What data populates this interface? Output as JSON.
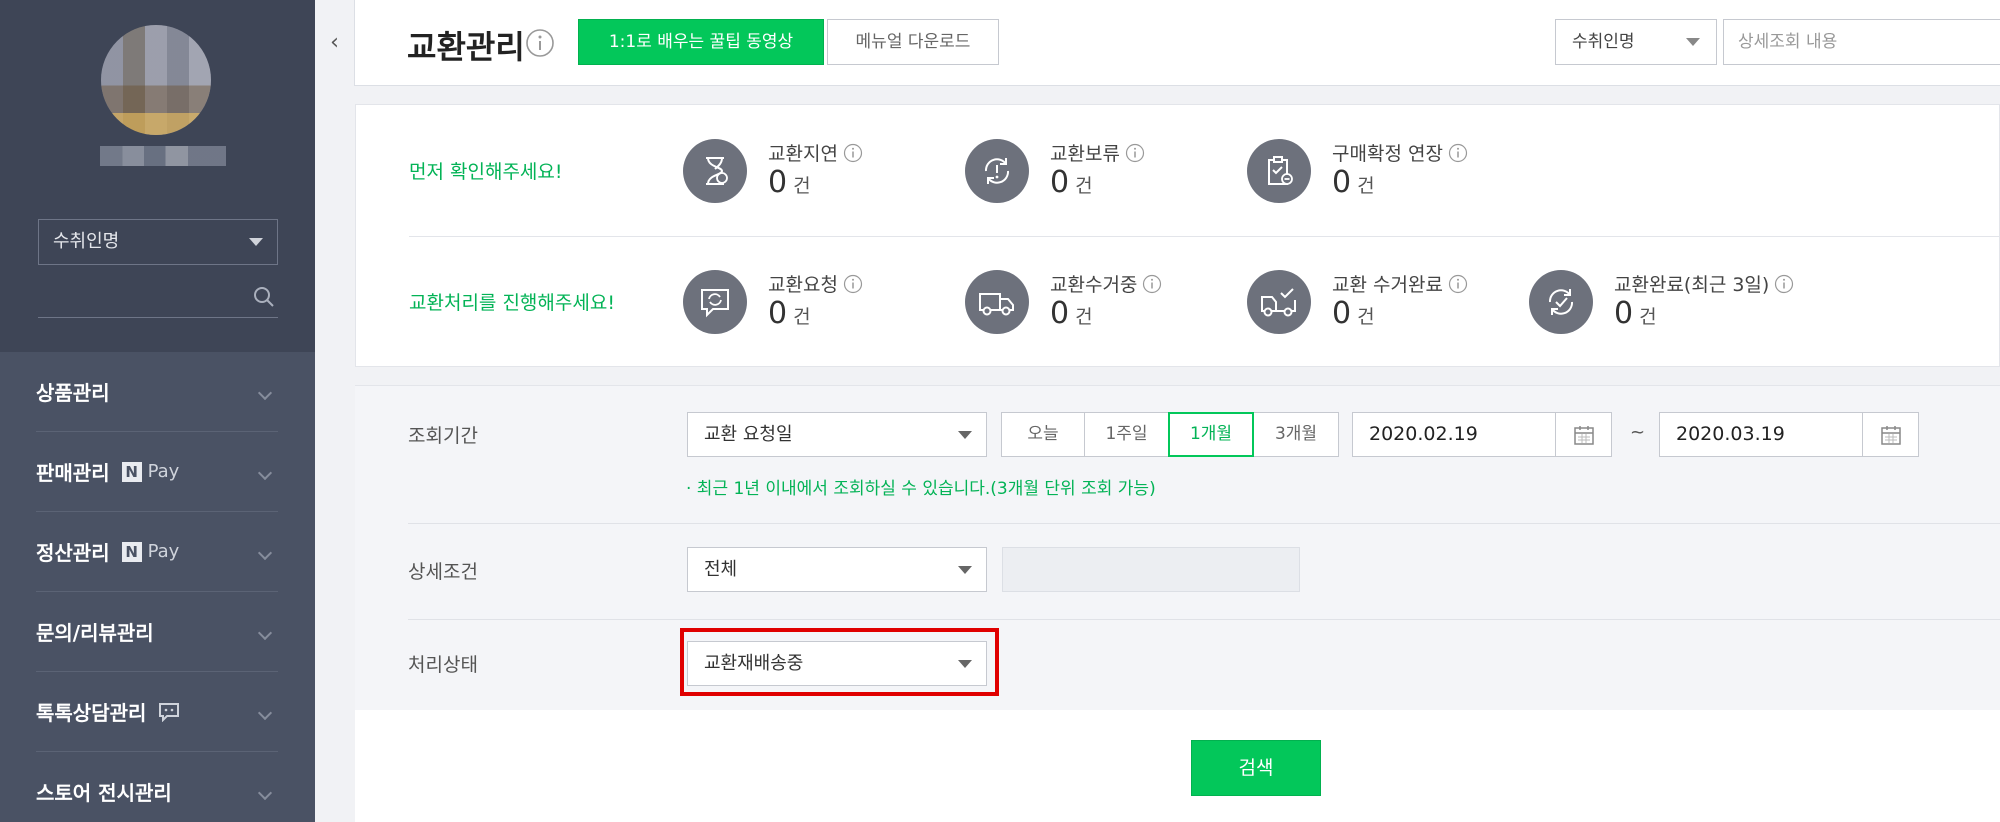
{
  "sidebar": {
    "account_select": "수취인명",
    "menu": [
      {
        "label": "상품관리",
        "badge": null
      },
      {
        "label": "판매관리",
        "badge": "Pay"
      },
      {
        "label": "정산관리",
        "badge": "Pay"
      },
      {
        "label": "문의/리뷰관리",
        "badge": null
      },
      {
        "label": "톡톡상담관리",
        "badge": "talk"
      },
      {
        "label": "스토어 전시관리",
        "badge": null
      }
    ],
    "npay_letter": "N"
  },
  "header": {
    "collapse_glyph": "‹",
    "title": "교환관리",
    "video_button": "1:1로 배우는 꿀팁 동영상",
    "manual_button": "메뉴얼 다운로드",
    "search_type": "수취인명",
    "search_placeholder": "상세조회 내용"
  },
  "status": {
    "row1_label": "먼저 확인해주세요!",
    "row2_label": "교환처리를 진행해주세요!",
    "unit": "건",
    "row1": [
      {
        "label": "교환지연",
        "count": "0",
        "icon": "hourglass-icon"
      },
      {
        "label": "교환보류",
        "count": "0",
        "icon": "hold-icon"
      },
      {
        "label": "구매확정 연장",
        "count": "0",
        "icon": "clipboard-icon"
      }
    ],
    "row2": [
      {
        "label": "교환요청",
        "count": "0",
        "icon": "exchange-request-icon"
      },
      {
        "label": "교환수거중",
        "count": "0",
        "icon": "truck-icon"
      },
      {
        "label": "교환 수거완료",
        "count": "0",
        "icon": "truck-check-icon"
      },
      {
        "label": "교환완료(최근 3일)",
        "count": "0",
        "icon": "refresh-check-icon"
      }
    ]
  },
  "filter": {
    "period_label": "조회기간",
    "period_type": "교환 요청일",
    "periods": [
      "오늘",
      "1주일",
      "1개월",
      "3개월"
    ],
    "active_period": "1개월",
    "date_from": "2020.02.19",
    "date_to": "2020.03.19",
    "tilde": "~",
    "hint": "· 최근 1년 이내에서 조회하실 수 있습니다.(3개월 단위 조회 가능)",
    "detail_label": "상세조건",
    "detail_value": "전체",
    "status_label": "처리상태",
    "status_value": "교환재배송중"
  },
  "search_button": "검색",
  "colors": {
    "accent": "#03c75a",
    "sidebar": "#4a5264",
    "highlight": "#e00000"
  }
}
